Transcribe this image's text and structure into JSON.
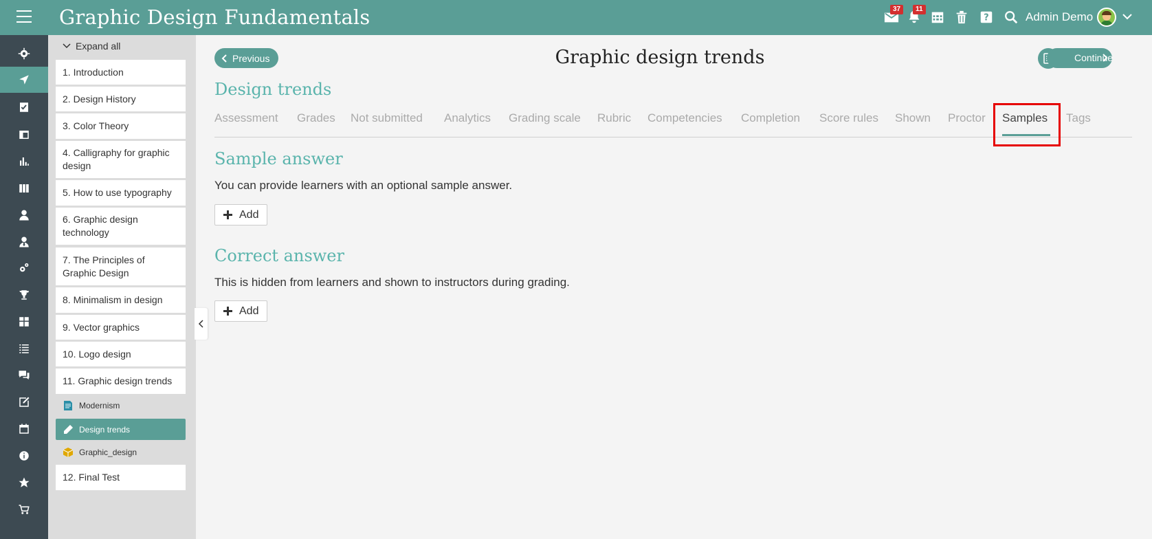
{
  "header": {
    "title": "Graphic Design Fundamentals",
    "messages_badge": "37",
    "notifications_badge": "11",
    "user_name": "Admin Demo"
  },
  "outline": {
    "expand_all": "Expand all",
    "chapters": [
      "1. Introduction",
      "2. Design History",
      "3. Color Theory",
      "4. Calligraphy for graphic design",
      "5. How to use typography",
      "6. Graphic design technology",
      "7. The Principles of Graphic Design",
      "8. Minimalism in design",
      "9. Vector graphics",
      "10. Logo design",
      "11. Graphic design trends",
      "12. Final Test"
    ],
    "subitems": [
      "Modernism",
      "Design trends",
      "Graphic_design"
    ]
  },
  "main": {
    "prev_label": "Previous",
    "continue_label": "Continue",
    "page_title": "Graphic design trends",
    "section_title": "Design trends",
    "tabs": [
      "Assessment",
      "Grades",
      "Not submitted",
      "Analytics",
      "Grading scale",
      "Rubric",
      "Competencies",
      "Completion",
      "Score rules",
      "Shown",
      "Proctor",
      "Samples",
      "Tags"
    ],
    "active_tab": "Samples",
    "sample": {
      "title": "Sample answer",
      "desc": "You can provide learners with an optional sample answer.",
      "add_label": "Add"
    },
    "correct": {
      "title": "Correct answer",
      "desc": "This is hidden from learners and shown to instructors during grading.",
      "add_label": "Add"
    }
  },
  "colors": {
    "accent": "#5a9e96",
    "rail": "#3d4a52",
    "highlight": "#e60000"
  }
}
